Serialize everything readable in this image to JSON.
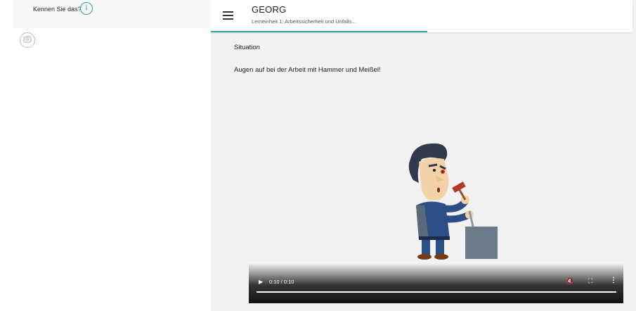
{
  "left_panel": {
    "question": "Kennen Sie das?",
    "info_icon": "info-icon",
    "chat_icon": "chat-bubble-icon"
  },
  "app_bar": {
    "title": "GEORG",
    "subtitle": "Lerneinheit 1: Arbeitssicherheit und Unfalls...",
    "menu_icon": "hamburger-menu-icon",
    "accent_color": "#26a69a"
  },
  "content": {
    "heading": "Situation",
    "text": "Augen auf bei der Arbeit mit Hammer und Meißel!"
  },
  "video": {
    "time": "0:10 / 0:10",
    "progress": 1.0,
    "icons": [
      "play-icon",
      "mute-icon",
      "fullscreen-icon",
      "more-options-icon"
    ]
  }
}
